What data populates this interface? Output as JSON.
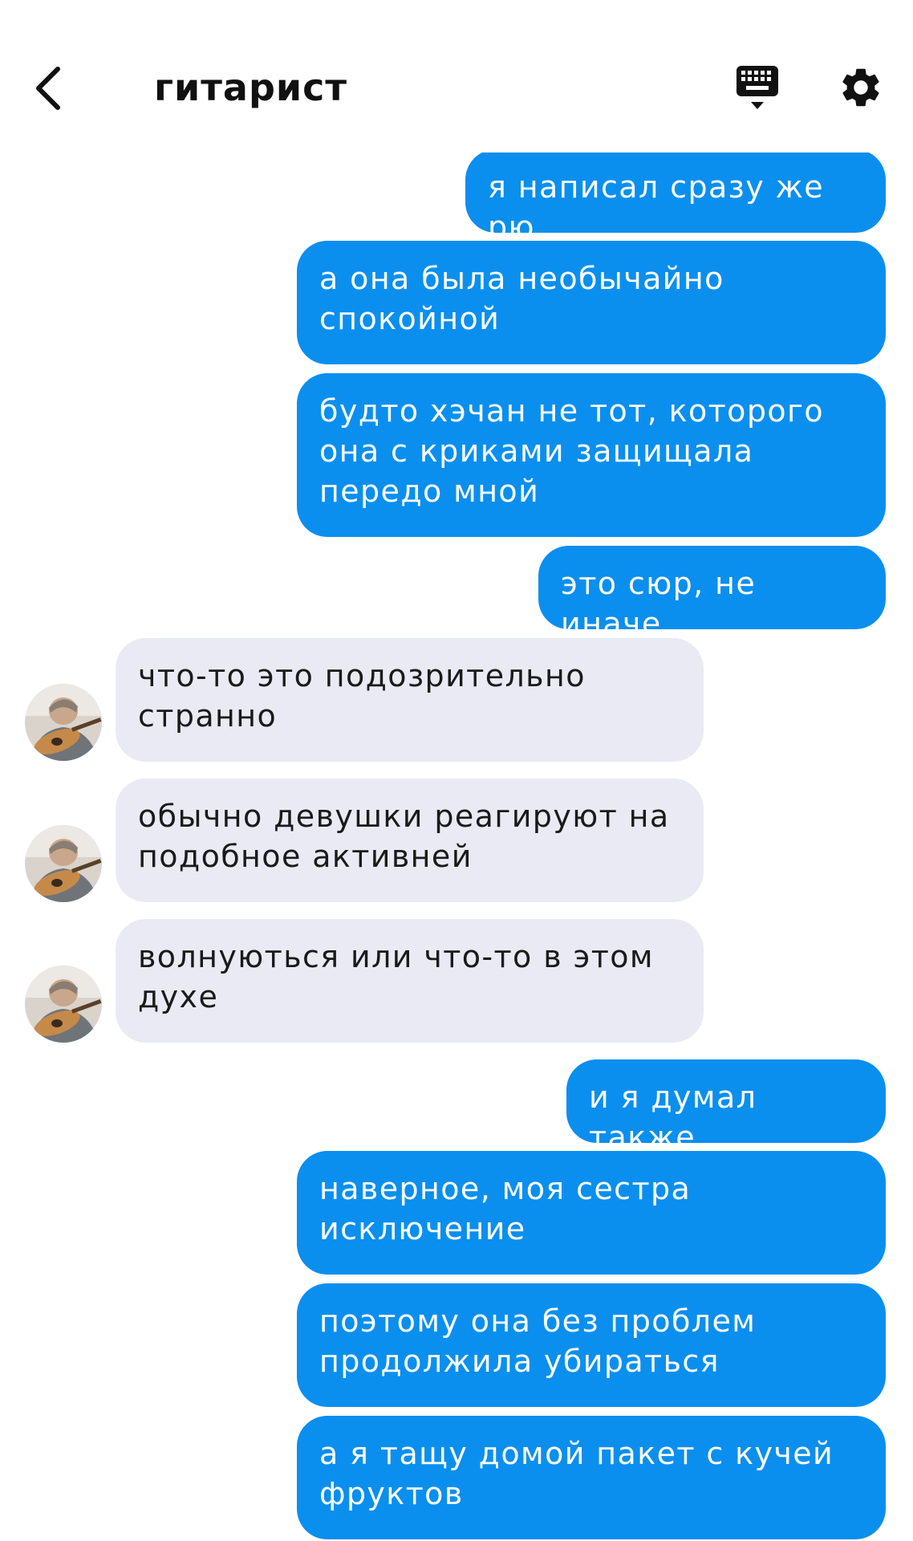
{
  "header": {
    "title": "гитарист",
    "back_icon": "chevron-left-icon",
    "keyboard_icon": "keyboard-icon",
    "settings_icon": "gear-icon"
  },
  "colors": {
    "outgoing_bubble": "#0a8fef",
    "incoming_bubble": "#e9eaf4",
    "background": "#ffffff"
  },
  "messages": [
    {
      "side": "out",
      "text": "я написал сразу же рю"
    },
    {
      "side": "out",
      "text": "а она была необычайно спокойной"
    },
    {
      "side": "out",
      "text": "будто хэчан не тот, которого она с криками защищала передо мной"
    },
    {
      "side": "out",
      "text": "это сюр, не иначе"
    },
    {
      "side": "in",
      "text": "что-то это подозрительно странно"
    },
    {
      "side": "in",
      "text": "обычно девушки реагируют на подобное активней"
    },
    {
      "side": "in",
      "text": "волнуються или что-то в этом духе"
    },
    {
      "side": "out",
      "text": "и я думал также"
    },
    {
      "side": "out",
      "text": "наверное, моя сестра исключение"
    },
    {
      "side": "out",
      "text": "поэтому она без проблем продолжила убираться"
    },
    {
      "side": "out",
      "text": "а я тащу домой пакет с кучей фруктов"
    }
  ]
}
